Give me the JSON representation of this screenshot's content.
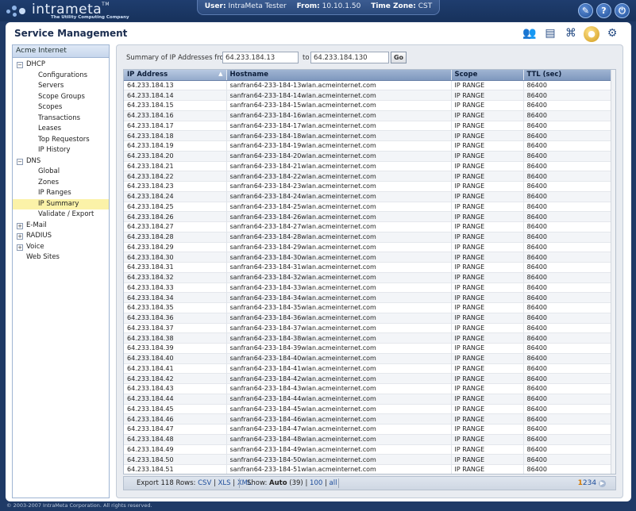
{
  "brand": {
    "name": "intrameta",
    "tagline": "The Utility Computing Company",
    "tm": "TM"
  },
  "session": {
    "user_label": "User:",
    "user_value": "IntraMeta Tester",
    "from_label": "From:",
    "from_value": "10.10.1.50",
    "timezone_label": "Time Zone:",
    "timezone_value": "CST"
  },
  "top_tools": [
    {
      "icon": "wrench-icon",
      "glyph": "✎"
    },
    {
      "icon": "help-icon",
      "glyph": "?"
    },
    {
      "icon": "power-icon",
      "glyph": "⏻"
    }
  ],
  "page": {
    "title": "Service Management"
  },
  "service_icons": [
    {
      "icon": "users-icon",
      "glyph": "👥"
    },
    {
      "icon": "id-card-icon",
      "glyph": "▤"
    },
    {
      "icon": "network-icon",
      "glyph": "⌘"
    },
    {
      "icon": "globe-icon",
      "glyph": "●"
    },
    {
      "icon": "gears-icon",
      "glyph": "⚙"
    }
  ],
  "sidebar": {
    "header": "Acme Internet",
    "dhcp": {
      "label": "DHCP",
      "children": [
        "Configurations",
        "Servers",
        "Scope Groups",
        "Scopes",
        "Transactions",
        "Leases",
        "Top Requestors",
        "IP History"
      ]
    },
    "dns": {
      "label": "DNS",
      "children": [
        "Global",
        "Zones",
        "IP Ranges",
        "IP Summary",
        "Validate / Export"
      ],
      "selected": "IP Summary"
    },
    "email": "E-Mail",
    "radius": "RADIUS",
    "voice": "Voice",
    "websites": "Web Sites"
  },
  "filter": {
    "label": "Summary of IP Addresses from",
    "from_value": "64.233.184.13",
    "to_label": "to",
    "to_value": "64.233.184.130",
    "go_label": "Go"
  },
  "table": {
    "columns": [
      "IP Address",
      "Hostname",
      "Scope",
      "TTL (sec)"
    ],
    "rows": [
      [
        "64.233.184.13",
        "sanfran64-233-184-13wlan.acmeinternet.com",
        "IP RANGE",
        "86400"
      ],
      [
        "64.233.184.14",
        "sanfran64-233-184-14wlan.acmeinternet.com",
        "IP RANGE",
        "86400"
      ],
      [
        "64.233.184.15",
        "sanfran64-233-184-15wlan.acmeinternet.com",
        "IP RANGE",
        "86400"
      ],
      [
        "64.233.184.16",
        "sanfran64-233-184-16wlan.acmeinternet.com",
        "IP RANGE",
        "86400"
      ],
      [
        "64.233.184.17",
        "sanfran64-233-184-17wlan.acmeinternet.com",
        "IP RANGE",
        "86400"
      ],
      [
        "64.233.184.18",
        "sanfran64-233-184-18wlan.acmeinternet.com",
        "IP RANGE",
        "86400"
      ],
      [
        "64.233.184.19",
        "sanfran64-233-184-19wlan.acmeinternet.com",
        "IP RANGE",
        "86400"
      ],
      [
        "64.233.184.20",
        "sanfran64-233-184-20wlan.acmeinternet.com",
        "IP RANGE",
        "86400"
      ],
      [
        "64.233.184.21",
        "sanfran64-233-184-21wlan.acmeinternet.com",
        "IP RANGE",
        "86400"
      ],
      [
        "64.233.184.22",
        "sanfran64-233-184-22wlan.acmeinternet.com",
        "IP RANGE",
        "86400"
      ],
      [
        "64.233.184.23",
        "sanfran64-233-184-23wlan.acmeinternet.com",
        "IP RANGE",
        "86400"
      ],
      [
        "64.233.184.24",
        "sanfran64-233-184-24wlan.acmeinternet.com",
        "IP RANGE",
        "86400"
      ],
      [
        "64.233.184.25",
        "sanfran64-233-184-25wlan.acmeinternet.com",
        "IP RANGE",
        "86400"
      ],
      [
        "64.233.184.26",
        "sanfran64-233-184-26wlan.acmeinternet.com",
        "IP RANGE",
        "86400"
      ],
      [
        "64.233.184.27",
        "sanfran64-233-184-27wlan.acmeinternet.com",
        "IP RANGE",
        "86400"
      ],
      [
        "64.233.184.28",
        "sanfran64-233-184-28wlan.acmeinternet.com",
        "IP RANGE",
        "86400"
      ],
      [
        "64.233.184.29",
        "sanfran64-233-184-29wlan.acmeinternet.com",
        "IP RANGE",
        "86400"
      ],
      [
        "64.233.184.30",
        "sanfran64-233-184-30wlan.acmeinternet.com",
        "IP RANGE",
        "86400"
      ],
      [
        "64.233.184.31",
        "sanfran64-233-184-31wlan.acmeinternet.com",
        "IP RANGE",
        "86400"
      ],
      [
        "64.233.184.32",
        "sanfran64-233-184-32wlan.acmeinternet.com",
        "IP RANGE",
        "86400"
      ],
      [
        "64.233.184.33",
        "sanfran64-233-184-33wlan.acmeinternet.com",
        "IP RANGE",
        "86400"
      ],
      [
        "64.233.184.34",
        "sanfran64-233-184-34wlan.acmeinternet.com",
        "IP RANGE",
        "86400"
      ],
      [
        "64.233.184.35",
        "sanfran64-233-184-35wlan.acmeinternet.com",
        "IP RANGE",
        "86400"
      ],
      [
        "64.233.184.36",
        "sanfran64-233-184-36wlan.acmeinternet.com",
        "IP RANGE",
        "86400"
      ],
      [
        "64.233.184.37",
        "sanfran64-233-184-37wlan.acmeinternet.com",
        "IP RANGE",
        "86400"
      ],
      [
        "64.233.184.38",
        "sanfran64-233-184-38wlan.acmeinternet.com",
        "IP RANGE",
        "86400"
      ],
      [
        "64.233.184.39",
        "sanfran64-233-184-39wlan.acmeinternet.com",
        "IP RANGE",
        "86400"
      ],
      [
        "64.233.184.40",
        "sanfran64-233-184-40wlan.acmeinternet.com",
        "IP RANGE",
        "86400"
      ],
      [
        "64.233.184.41",
        "sanfran64-233-184-41wlan.acmeinternet.com",
        "IP RANGE",
        "86400"
      ],
      [
        "64.233.184.42",
        "sanfran64-233-184-42wlan.acmeinternet.com",
        "IP RANGE",
        "86400"
      ],
      [
        "64.233.184.43",
        "sanfran64-233-184-43wlan.acmeinternet.com",
        "IP RANGE",
        "86400"
      ],
      [
        "64.233.184.44",
        "sanfran64-233-184-44wlan.acmeinternet.com",
        "IP RANGE",
        "86400"
      ],
      [
        "64.233.184.45",
        "sanfran64-233-184-45wlan.acmeinternet.com",
        "IP RANGE",
        "86400"
      ],
      [
        "64.233.184.46",
        "sanfran64-233-184-46wlan.acmeinternet.com",
        "IP RANGE",
        "86400"
      ],
      [
        "64.233.184.47",
        "sanfran64-233-184-47wlan.acmeinternet.com",
        "IP RANGE",
        "86400"
      ],
      [
        "64.233.184.48",
        "sanfran64-233-184-48wlan.acmeinternet.com",
        "IP RANGE",
        "86400"
      ],
      [
        "64.233.184.49",
        "sanfran64-233-184-49wlan.acmeinternet.com",
        "IP RANGE",
        "86400"
      ],
      [
        "64.233.184.50",
        "sanfran64-233-184-50wlan.acmeinternet.com",
        "IP RANGE",
        "86400"
      ],
      [
        "64.233.184.51",
        "sanfran64-233-184-51wlan.acmeinternet.com",
        "IP RANGE",
        "86400"
      ]
    ]
  },
  "footer": {
    "export_label": "Export 118 Rows:",
    "export_csv": "CSV",
    "export_xls": "XLS",
    "export_xml": "XML",
    "show_label": "Show:",
    "show_auto": "Auto",
    "show_auto_count": "(39)",
    "show_100": "100",
    "show_all": "all",
    "pages": [
      "1",
      "2",
      "3",
      "4"
    ],
    "current_page": "1"
  },
  "copyright": "© 2003-2007 IntraMeta Corporation.  All rights reserved."
}
